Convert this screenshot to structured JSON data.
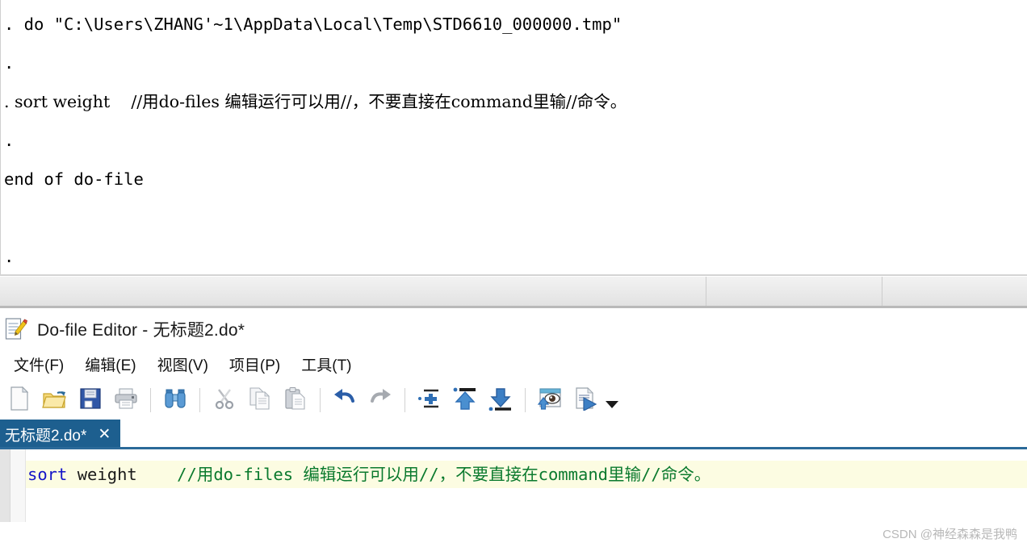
{
  "results": {
    "lines": [
      {
        "id": "cmd-do",
        "text": ". do \"C:\\Users\\ZHANG'~1\\AppData\\Local\\Temp\\STD6610_000000.tmp\"",
        "cjk": false
      },
      {
        "id": "dot-1",
        "text": ".",
        "cjk": false
      },
      {
        "id": "cmd-sort",
        "text": ". sort weight    //用do-files 编辑运行可以用//，不要直接在command里输//命令。",
        "cjk": true
      },
      {
        "id": "dot-2",
        "text": ".",
        "cjk": false
      },
      {
        "id": "end-do",
        "text": "end of do-file",
        "cjk": false
      },
      {
        "id": "blank-1",
        "text": "",
        "cjk": false
      },
      {
        "id": "dot-3",
        "text": ".",
        "cjk": false
      }
    ]
  },
  "status_bar": {
    "main": "",
    "mid": "",
    "last": ""
  },
  "editor": {
    "title": "Do-file Editor - 无标题2.do*",
    "icon": "do-file-editor-icon",
    "menus": [
      {
        "id": "file",
        "label": "文件(F)"
      },
      {
        "id": "edit",
        "label": "编辑(E)"
      },
      {
        "id": "view",
        "label": "视图(V)"
      },
      {
        "id": "project",
        "label": "项目(P)"
      },
      {
        "id": "tools",
        "label": "工具(T)"
      }
    ],
    "toolbar": [
      {
        "id": "new",
        "icon": "new-file-icon",
        "title": "新建"
      },
      {
        "id": "open",
        "icon": "open-folder-icon",
        "title": "打开"
      },
      {
        "id": "save",
        "icon": "save-floppy-icon",
        "title": "保存"
      },
      {
        "id": "print",
        "icon": "printer-icon",
        "title": "打印"
      },
      {
        "id": "sep1",
        "icon": "separator",
        "title": ""
      },
      {
        "id": "find",
        "icon": "binoculars-icon",
        "title": "查找"
      },
      {
        "id": "sep2",
        "icon": "separator",
        "title": ""
      },
      {
        "id": "cut",
        "icon": "scissors-icon",
        "title": "剪切"
      },
      {
        "id": "copy",
        "icon": "copy-icon",
        "title": "复制"
      },
      {
        "id": "paste",
        "icon": "paste-icon",
        "title": "粘贴"
      },
      {
        "id": "sep3",
        "icon": "separator",
        "title": ""
      },
      {
        "id": "undo",
        "icon": "undo-arrow-icon",
        "title": "撤销"
      },
      {
        "id": "redo",
        "icon": "redo-arrow-icon",
        "title": "重做"
      },
      {
        "id": "sep4",
        "icon": "separator",
        "title": ""
      },
      {
        "id": "insert",
        "icon": "insert-plus-icon",
        "title": "插入"
      },
      {
        "id": "moveup",
        "icon": "arrow-up-icon",
        "title": "上移"
      },
      {
        "id": "movedown",
        "icon": "arrow-down-icon",
        "title": "下移"
      },
      {
        "id": "sep5",
        "icon": "separator",
        "title": ""
      },
      {
        "id": "preview",
        "icon": "preview-eye-icon",
        "title": "预览"
      },
      {
        "id": "execute",
        "icon": "run-dofile-icon",
        "title": "执行"
      },
      {
        "id": "execmenu",
        "icon": "chevron-down-icon",
        "title": "执行选项"
      }
    ],
    "tab": {
      "label": "无标题2.do*",
      "close": "✕"
    },
    "code": {
      "lines": [
        {
          "id": "line-1",
          "current": true,
          "tokens": [
            {
              "type": "kw",
              "text": "sort"
            },
            {
              "type": "plain",
              "text": " weight    "
            },
            {
              "type": "comment",
              "text": "//"
            },
            {
              "type": "comment-cjk",
              "text": "用"
            },
            {
              "type": "comment",
              "text": "do-files "
            },
            {
              "type": "comment-cjk",
              "text": "编辑运行可以用"
            },
            {
              "type": "comment",
              "text": "//"
            },
            {
              "type": "comment-cjk",
              "text": "，不要直接在"
            },
            {
              "type": "comment",
              "text": "command"
            },
            {
              "type": "comment-cjk",
              "text": "里输"
            },
            {
              "type": "comment",
              "text": "//"
            },
            {
              "type": "comment-cjk",
              "text": "命令。"
            }
          ]
        }
      ]
    }
  },
  "watermark": {
    "text": "CSDN @神经森森是我鸭"
  },
  "colors": {
    "tab_active_bg": "#1d5f8f",
    "tab_underline": "#2b6a99",
    "current_line_highlight": "#fcfce2",
    "keyword": "#1414c8",
    "comment": "#0b7a2e",
    "status_bar_bg": "#eaeaea"
  }
}
